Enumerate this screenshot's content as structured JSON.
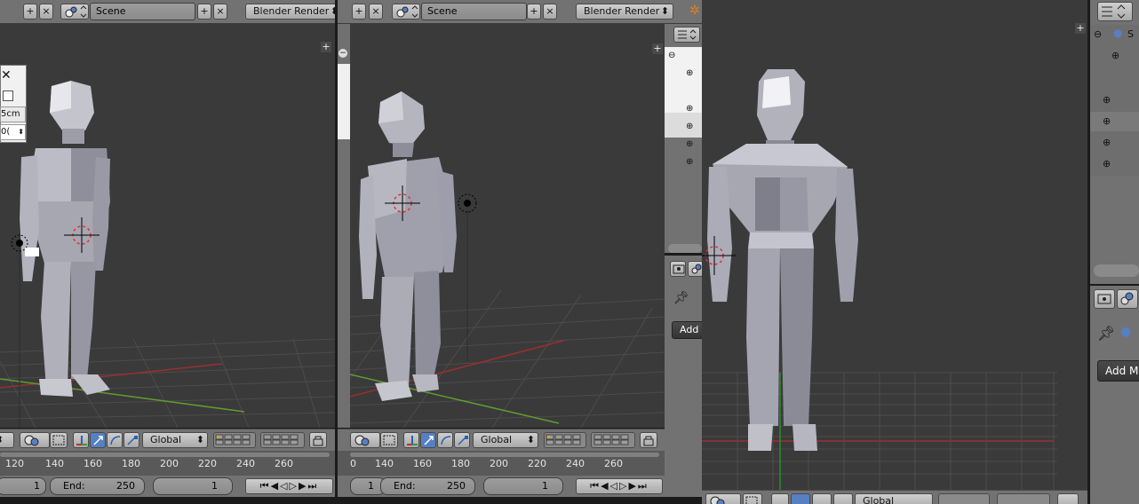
{
  "shot_a": {
    "header": {
      "scene": "Scene",
      "engine": "Blender Render"
    },
    "dialog": {
      "value1": "5cm",
      "value2": "0("
    },
    "toolbar": {
      "orientation": "Global"
    },
    "timeline_ticks": [
      "120",
      "140",
      "160",
      "180",
      "200",
      "220",
      "240",
      "260"
    ],
    "frames": {
      "current": "1",
      "end_label": "End:",
      "end": "250",
      "frame": "1"
    }
  },
  "shot_b": {
    "header": {
      "scene": "Scene",
      "engine": "Blender Render"
    },
    "toolbar": {
      "orientation": "Global"
    },
    "timeline_ticks": [
      "0",
      "140",
      "160",
      "180",
      "200",
      "220",
      "240",
      "260"
    ],
    "frames": {
      "current": "1",
      "end_label": "End:",
      "end": "250",
      "frame": "1"
    },
    "props_button": "Add l"
  },
  "shot_c": {
    "outliner_label": "S",
    "props_button": "Add M",
    "toolbar": {
      "orientation": "Global"
    }
  },
  "colors": {
    "viewport": "#3a3a3a",
    "header": "#727272",
    "accent_blue": "#5680c2",
    "x_axis": "#9a2f2f",
    "y_axis": "#5f9c2f"
  }
}
